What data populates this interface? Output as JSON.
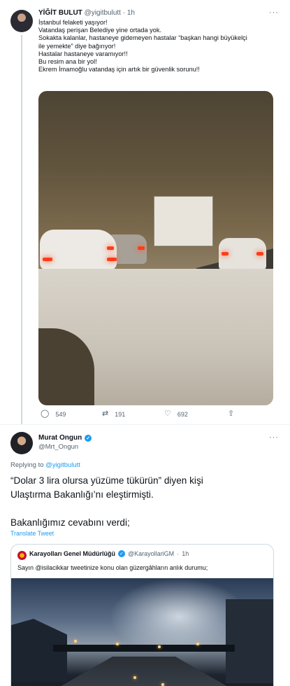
{
  "tweet1": {
    "name": "YİĞİT BULUT",
    "handle": "@yigitbulutt",
    "time": "1h",
    "more": "···",
    "lines": [
      "İstanbul felaketi yaşıyor!",
      "Vatandaş perişan Belediye yine ortada yok.",
      "Sokakta kalanlar, hastaneye gidemeyen hastalar “başkan hangi büyükelçi",
      "ile yemekte” diye bağırıyor!",
      "Hastalar hastaneye varamıyor!!",
      "Bu resim ana bir yol!",
      "Ekrem İmamoğlu vatandaş için artık bir güvenlik sorunu!!"
    ],
    "actions": {
      "replies": "549",
      "retweets": "191",
      "likes": "692"
    }
  },
  "tweet2": {
    "name": "Murat Ongun",
    "handle": "@Mrt_Ongun",
    "more": "···",
    "replying_prefix": "Replying to",
    "replying_to": "@yigitbulutt",
    "lines": [
      "“Dolar 3 lira olursa yüzüme tükürün” diyen kişi",
      "Ulaştırma Bakanlığı’nı eleştirmişti.",
      "",
      "Bakanlığımız cevabını verdi;"
    ],
    "translate": "Translate Tweet"
  },
  "quote": {
    "name": "Karayolları Genel Müdürlüğü",
    "handle": "@KarayollariGM",
    "time": "1h",
    "text": "Sayın @isilacikkar tweetinize konu olan güzergâhların anlık durumu;"
  },
  "icons": {
    "reply": "reply-icon",
    "retweet": "retweet-icon",
    "like": "heart-icon",
    "share": "share-icon",
    "verified": "verified-badge-icon"
  },
  "colors": {
    "link": "#1d9bf0",
    "muted": "#536471",
    "text": "#0f1419",
    "border": "#cfd9de"
  }
}
